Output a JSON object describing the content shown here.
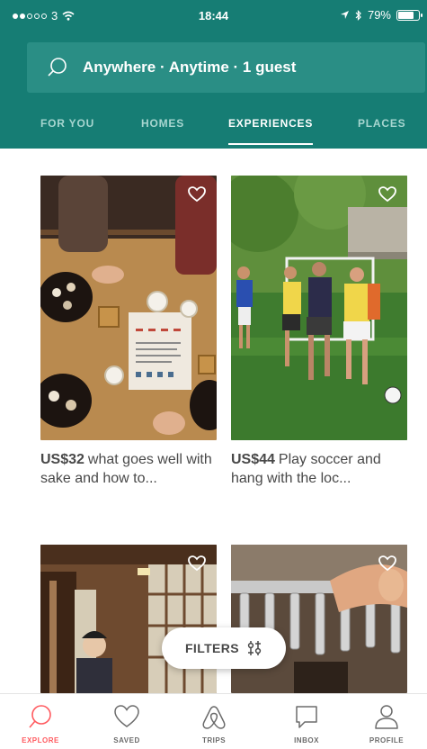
{
  "status_bar": {
    "carrier": "3",
    "time": "18:44",
    "battery_percent": "79%",
    "battery_level": 0.79
  },
  "search": {
    "summary": "Anywhere · Anytime · 1 guest"
  },
  "tabs": [
    {
      "label": "FOR YOU",
      "active": false
    },
    {
      "label": "HOMES",
      "active": false
    },
    {
      "label": "EXPERIENCES",
      "active": true
    },
    {
      "label": "PLACES",
      "active": false
    }
  ],
  "experiences": [
    {
      "price": "US$32",
      "title": "what goes well with sake and how to...",
      "saved": false
    },
    {
      "price": "US$44",
      "title": "Play soccer and hang with the loc...",
      "saved": false
    },
    {
      "price": "",
      "title": "",
      "saved": false
    },
    {
      "price": "",
      "title": "",
      "saved": false
    }
  ],
  "filters_button": {
    "label": "FILTERS"
  },
  "bottom_nav": [
    {
      "label": "EXPLORE",
      "icon": "search-icon",
      "active": true
    },
    {
      "label": "SAVED",
      "icon": "heart-icon",
      "active": false
    },
    {
      "label": "TRIPS",
      "icon": "airbnb-logo-icon",
      "active": false
    },
    {
      "label": "INBOX",
      "icon": "chat-bubble-icon",
      "active": false
    },
    {
      "label": "PROFILE",
      "icon": "person-icon",
      "active": false
    }
  ],
  "colors": {
    "brand_teal": "#167d74",
    "accent_red": "#ff5a5f"
  }
}
